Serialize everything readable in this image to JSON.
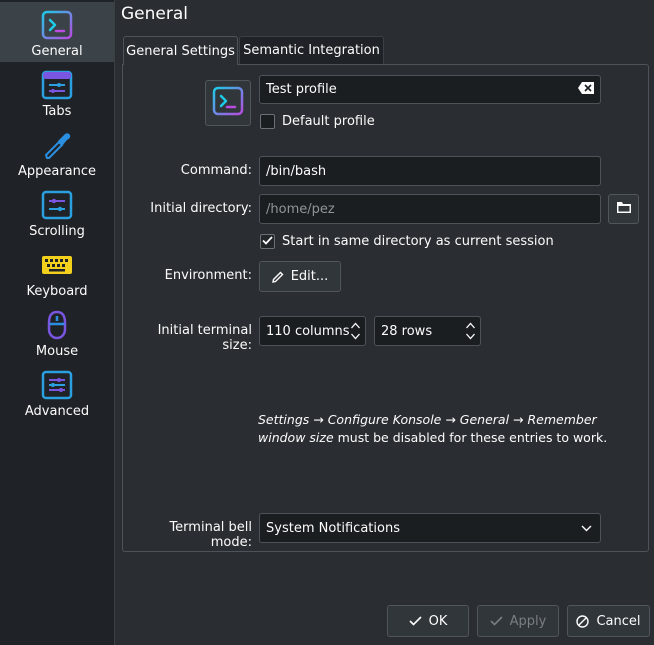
{
  "sidebar": {
    "items": [
      {
        "label": "General",
        "icon": "konsole-icon"
      },
      {
        "label": "Tabs",
        "icon": "tabs-icon"
      },
      {
        "label": "Appearance",
        "icon": "color-picker-icon"
      },
      {
        "label": "Scrolling",
        "icon": "scrolling-icon"
      },
      {
        "label": "Keyboard",
        "icon": "keyboard-icon"
      },
      {
        "label": "Mouse",
        "icon": "mouse-icon"
      },
      {
        "label": "Advanced",
        "icon": "advanced-icon"
      }
    ]
  },
  "page": {
    "title": "General"
  },
  "tabs": [
    {
      "label": "General Settings"
    },
    {
      "label": "Semantic Integration"
    }
  ],
  "profile": {
    "name": "Test profile",
    "default_label": "Default profile",
    "default_checked": false
  },
  "command": {
    "label": "Command:",
    "value": "/bin/bash"
  },
  "initial_directory": {
    "label": "Initial directory:",
    "placeholder": "/home/pez",
    "same_dir_label": "Start in same directory as current session",
    "same_dir_checked": true
  },
  "environment": {
    "label": "Environment:",
    "button": "Edit..."
  },
  "terminal_size": {
    "label": "Initial terminal size:",
    "columns": "110 columns",
    "rows": "28 rows"
  },
  "note": {
    "italic": "Settings → Configure Konsole → General → Remember window size",
    "rest": " must be disabled for these entries to work."
  },
  "bell": {
    "label": "Terminal bell mode:",
    "value": "System Notifications"
  },
  "buttons": {
    "ok": "OK",
    "apply": "Apply",
    "cancel": "Cancel"
  },
  "colors": {
    "accent": "#3daee9",
    "konsole_cyan": "#1dcbe6",
    "keyboard_yellow": "#f2d01c"
  }
}
